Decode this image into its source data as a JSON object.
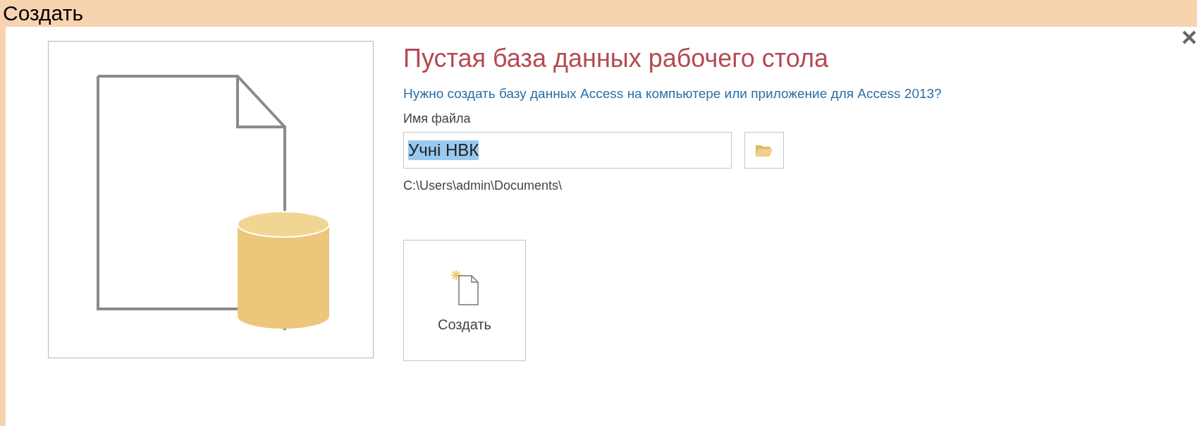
{
  "page_heading": "Создать",
  "dialog": {
    "title": "Пустая база данных рабочего стола",
    "subtitle": "Нужно создать базу данных Access на компьютере или приложение для Access 2013?",
    "file_name_label": "Имя файла",
    "file_name": {
      "value": "Учні НВК",
      "text_selected": true
    },
    "path": "C:\\Users\\admin\\Documents\\",
    "create_button": "Создать"
  }
}
